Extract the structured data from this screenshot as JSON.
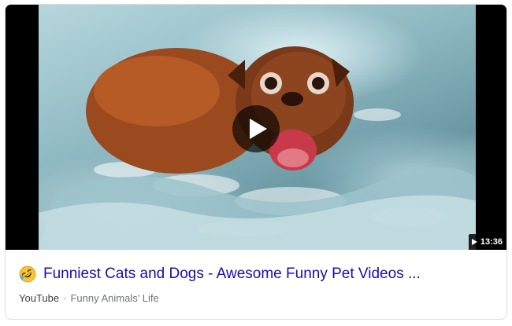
{
  "video": {
    "duration": "13:36",
    "title": "Funniest Cats and Dogs - Awesome Funny Pet Videos ...",
    "source": "YouTube",
    "separator": "·",
    "channel": "Funny Animals' Life",
    "title_emoji": "rolling-on-floor-laughing-emoji",
    "link_color": "#1a0dab"
  }
}
